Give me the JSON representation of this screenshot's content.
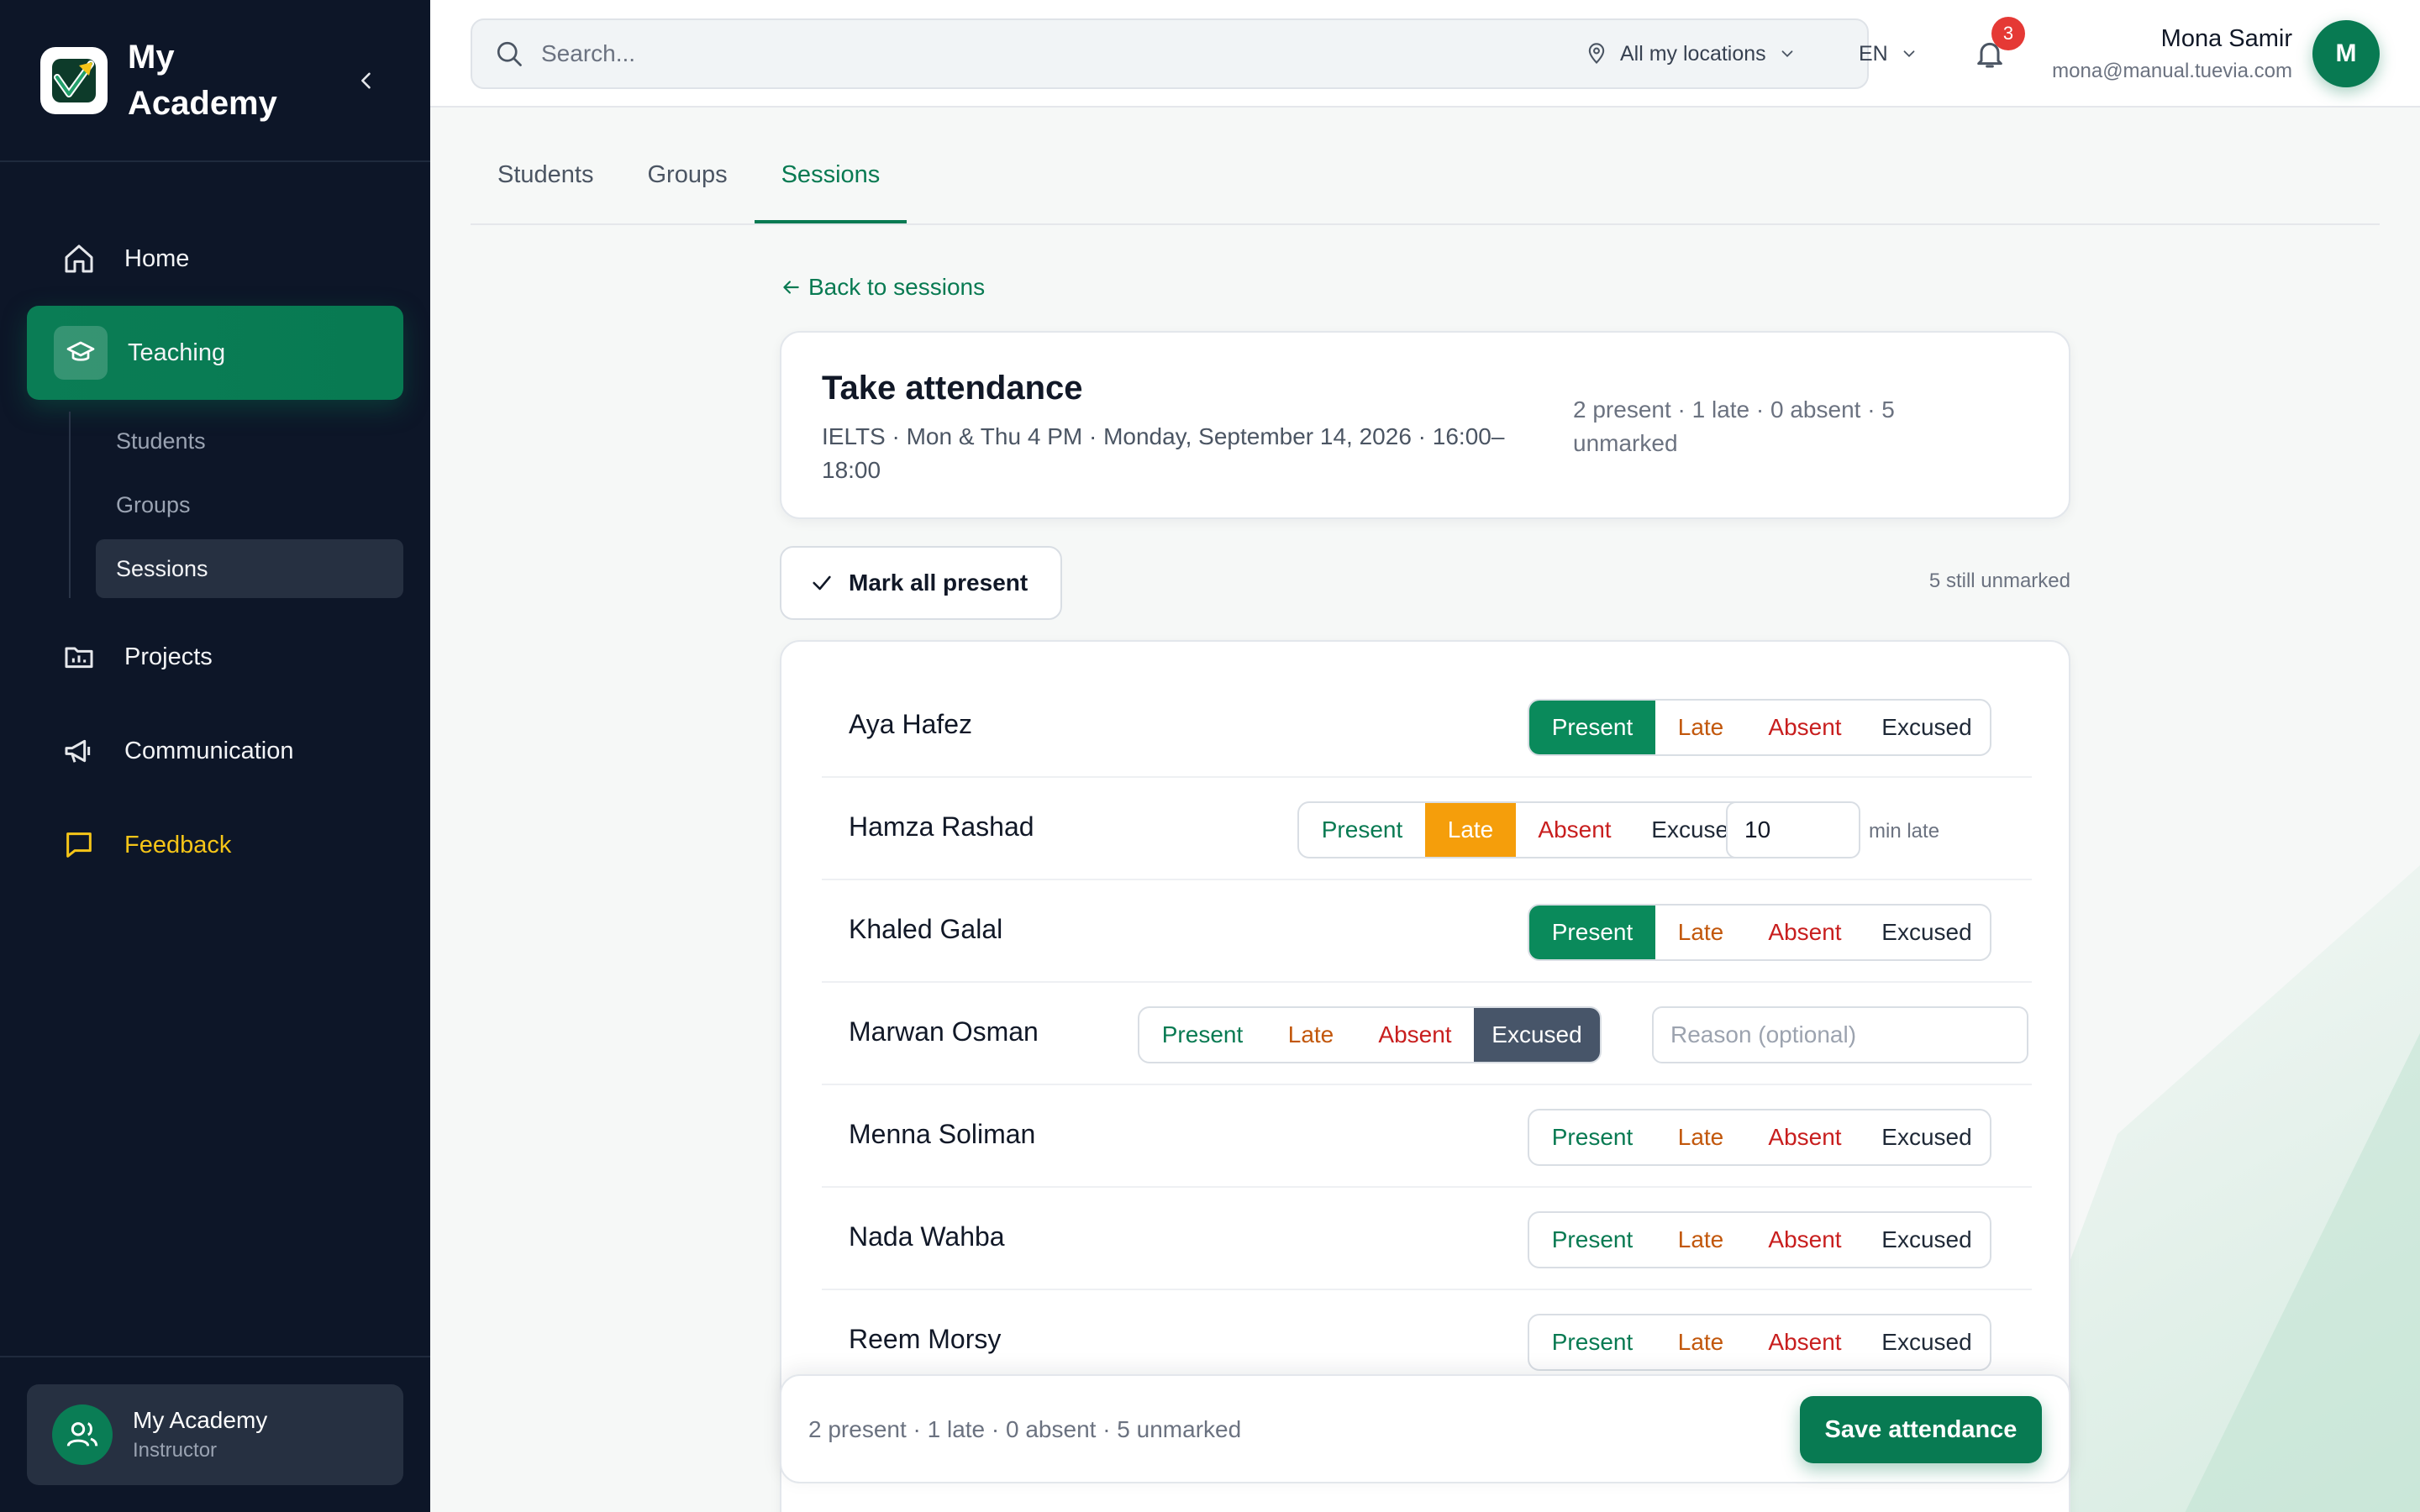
{
  "brand": {
    "name": "My Academy"
  },
  "sidebar": {
    "items": [
      {
        "label": "Home"
      },
      {
        "label": "Teaching"
      },
      {
        "label": "Projects"
      },
      {
        "label": "Communication"
      },
      {
        "label": "Feedback"
      }
    ],
    "sub_items": [
      {
        "label": "Students"
      },
      {
        "label": "Groups"
      },
      {
        "label": "Sessions"
      }
    ],
    "footer": {
      "name": "My Academy",
      "role": "Instructor"
    }
  },
  "topbar": {
    "search_placeholder": "Search...",
    "location": "All my locations",
    "language": "EN",
    "notifications": "3",
    "user_name": "Mona Samir",
    "user_email": "mona@manual.tuevia.com",
    "avatar_initial": "M"
  },
  "tabs": [
    {
      "label": "Students"
    },
    {
      "label": "Groups"
    },
    {
      "label": "Sessions"
    }
  ],
  "back_link": "Back to sessions",
  "attendance": {
    "title": "Take attendance",
    "subtitle": "IELTS · Mon & Thu 4 PM · Monday, September 14, 2026 · 16:00–18:00",
    "stats": "2 present · 1 late · 0 absent · 5 unmarked",
    "mark_all_label": "Mark all present",
    "still_unmarked": "5 still unmarked",
    "status_labels": {
      "present": "Present",
      "late": "Late",
      "absent": "Absent",
      "excused": "Excused"
    },
    "min_late_label": "min late",
    "reason_placeholder": "Reason (optional)",
    "students": [
      {
        "name": "Aya Hafez",
        "status": "present"
      },
      {
        "name": "Hamza Rashad",
        "status": "late",
        "minutes_late": "10"
      },
      {
        "name": "Khaled Galal",
        "status": "present"
      },
      {
        "name": "Marwan Osman",
        "status": "excused"
      },
      {
        "name": "Menna Soliman",
        "status": ""
      },
      {
        "name": "Nada Wahba",
        "status": ""
      },
      {
        "name": "Reem Morsy",
        "status": ""
      }
    ],
    "footer_stats": "2 present · 1 late · 0 absent · 5 unmarked",
    "save_label": "Save attendance"
  },
  "colors": {
    "accent": "#087a52",
    "sidebar_bg": "#0d1628",
    "late": "#f59e0b",
    "absent": "#c81e1e",
    "excused": "#475569",
    "feedback": "#f5c518"
  }
}
